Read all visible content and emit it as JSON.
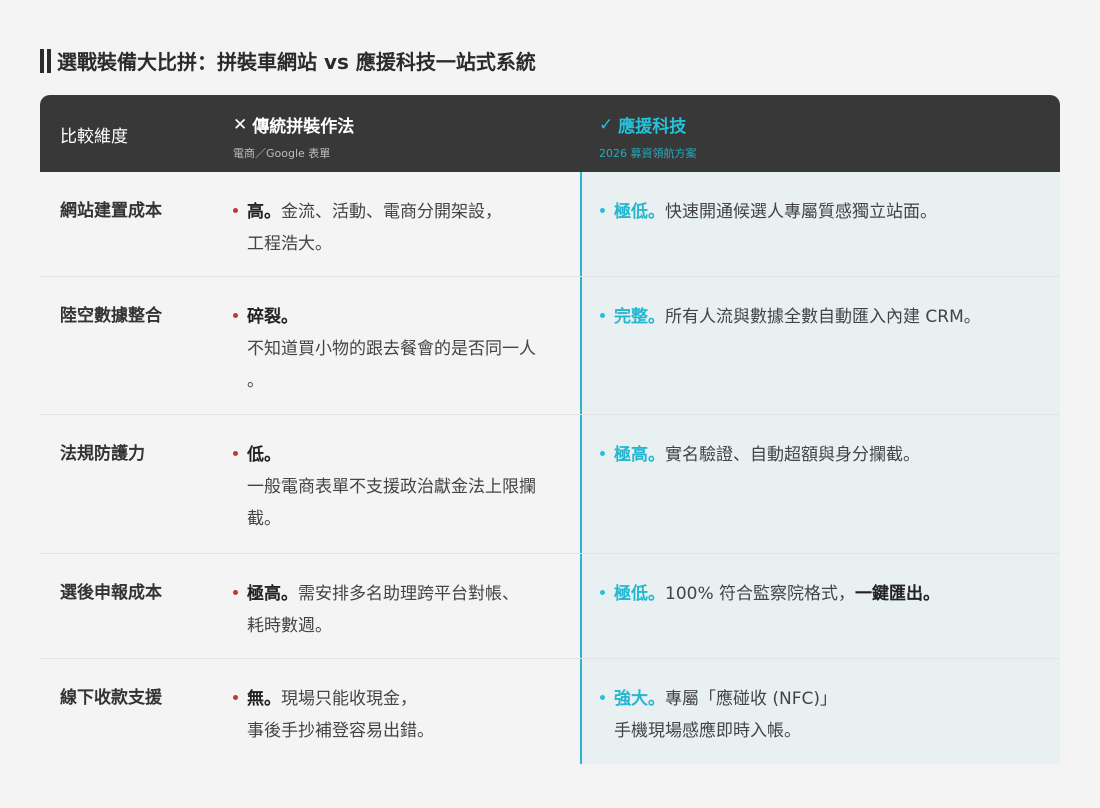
{
  "title": "選戰裝備大比拼：拼裝車網站 vs 應援科技一站式系統",
  "header": {
    "dimension": "比較維度",
    "traditional": {
      "mark": "✕",
      "label": "傳統拼裝作法",
      "sub": "電商／Google 表單"
    },
    "ours": {
      "mark": "✓",
      "label": "應援科技",
      "sub": "2026 募資領航方案"
    }
  },
  "rows": [
    {
      "dimension": "網站建置成本",
      "traditional": {
        "strong": "高。",
        "text1": "金流、活動、電商分開架設，",
        "text2": "工程浩大。"
      },
      "ours": {
        "strong": "極低。",
        "text1": "快速開通候選人專屬質感獨立站面。",
        "text2": "",
        "strong2": ""
      }
    },
    {
      "dimension": "陸空數據整合",
      "traditional": {
        "strong": "碎裂。",
        "text1": "",
        "text2": "不知道買小物的跟去餐會的是否同一人",
        "text3": "。"
      },
      "ours": {
        "strong": "完整。",
        "text1": "所有人流與數據全數自動匯入內建 CRM。"
      }
    },
    {
      "dimension": "法規防護力",
      "traditional": {
        "strong": "低。",
        "text2": "一般電商表單不支援政治獻金法上限攔",
        "text3": "截。"
      },
      "ours": {
        "strong": "極高。",
        "text1": "實名驗證、自動超額與身分攔截。"
      }
    },
    {
      "dimension": "選後申報成本",
      "traditional": {
        "strong": "極高。",
        "text1": "需安排多名助理跨平台對帳、",
        "text2": "耗時數週。"
      },
      "ours": {
        "strong": "極低。",
        "text1": "100% 符合監察院格式，",
        "strong2": "一鍵匯出。"
      }
    },
    {
      "dimension": "線下收款支援",
      "traditional": {
        "strong": "無。",
        "text1": "現場只能收現金，",
        "text2": "事後手抄補登容易出錯。"
      },
      "ours": {
        "strong": "強大。",
        "text1": "專屬「應碰收 (NFC)」",
        "text2": "手機現場感應即時入帳。"
      }
    }
  ]
}
